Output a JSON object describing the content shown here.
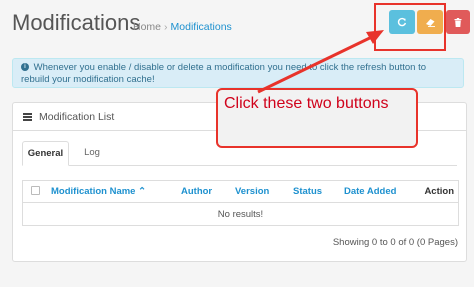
{
  "header": {
    "title": "Modifications",
    "breadcrumb": {
      "home": "Home",
      "separator": "›",
      "current": "Modifications"
    }
  },
  "toolbar": {
    "refresh_icon": "refresh-icon",
    "clear_icon": "eraser-icon",
    "delete_icon": "trash-icon",
    "colors": {
      "refresh": "#5bc0de",
      "clear": "#f0ad4e",
      "delete": "#e05a5a"
    }
  },
  "alert": {
    "text": "Whenever you enable / disable or delete a modification you need to click the refresh button to rebuild your modification cache!"
  },
  "panel": {
    "title": "Modification List",
    "tabs": [
      {
        "label": "General"
      },
      {
        "label": "Log"
      }
    ],
    "table": {
      "headers": {
        "name": "Modification Name ⌃",
        "author": "Author",
        "version": "Version",
        "status": "Status",
        "date_added": "Date Added",
        "action": "Action"
      },
      "empty_text": "No results!"
    },
    "pagination": "Showing 0 to 0 of 0 (0 Pages)"
  },
  "annotation": {
    "callout_text": "Click these two buttons",
    "color": "#e8332b"
  }
}
